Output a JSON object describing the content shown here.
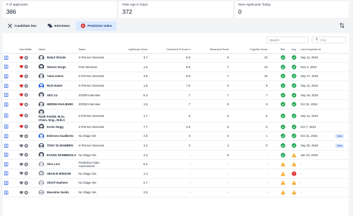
{
  "kpis": [
    {
      "label": "# of applicants",
      "value": "386"
    },
    {
      "label": "Role Age in Days",
      "value": "372"
    },
    {
      "label": "New Applicants Today",
      "value": "0"
    }
  ],
  "tabs": [
    {
      "label": "Candidate Sea",
      "icon": "candidate-search-icon",
      "active": false
    },
    {
      "label": "Interviews",
      "icon": "chat-bubbles-icon",
      "active": false
    },
    {
      "label": "Predictive Index",
      "icon": "pi-logo-icon",
      "active": true
    }
  ],
  "search": {
    "placeholder": "Search"
  },
  "filter": {
    "label": "Filter"
  },
  "columns": {
    "profile": "",
    "like_dislike": "Like Dislike",
    "name": "Name",
    "status": "Status",
    "lighthouse": "Lighthouse Score",
    "combined": "Combined Fit Score ▾",
    "behavioral": "Behavioral Score",
    "cognitive": "Cognitive Score",
    "bell": "Belt",
    "cog": "Cog",
    "last_completed": "Last Completed At",
    "badge": ""
  },
  "rows": [
    {
      "name": "Rahul Shinde",
      "avatar": "dark",
      "liked": true,
      "status": "In-Person Interview",
      "lighthouse": "3.7",
      "combined": "8.5",
      "behavioral": "9",
      "cognitive": "10",
      "bell": "ok",
      "cog": "ok",
      "date": "Sep 11, 2024",
      "badge": ""
    },
    {
      "name": "Steven Sorge",
      "avatar": "dark",
      "liked": true,
      "status": "First Interview",
      "lighthouse": "1.6",
      "combined": "8.5",
      "behavioral": "7",
      "cognitive": "10",
      "bell": "ok",
      "cog": "ok",
      "date": "Nov 4, 2024",
      "badge": ""
    },
    {
      "name": "Yaiza Azeez",
      "avatar": "dark",
      "liked": true,
      "status": "In-Person Interview",
      "lighthouse": "3.9",
      "combined": "8.5",
      "behavioral": "7",
      "cognitive": "10",
      "bell": "ok",
      "cog": "ok",
      "date": "Sep 17, 2024",
      "badge": ""
    },
    {
      "name": "Rick Hatter",
      "avatar": "blue",
      "liked": true,
      "status": "In-Person Interview",
      "lighthouse": "1.8",
      "combined": "7.5",
      "behavioral": "6",
      "cognitive": "9",
      "bell": "ok",
      "cog": "ok",
      "date": "Sep 11, 2024",
      "badge": ""
    },
    {
      "name": "SEX LU",
      "avatar": "dark",
      "liked": true,
      "status": "ZOOM Interview",
      "lighthouse": "5.3",
      "combined": "7",
      "behavioral": "7",
      "cognitive": "7",
      "bell": "ok",
      "cog": "ok",
      "date": "Sep 16, 2024",
      "badge": ""
    },
    {
      "name": "HEDEH KHAJEHEI",
      "avatar": "dark",
      "liked": true,
      "status": "ZOOM Interview",
      "lighthouse": "1.5",
      "combined": "7",
      "behavioral": "5",
      "cognitive": "9",
      "bell": "ok",
      "cog": "ok",
      "date": "Oct 31, 2024",
      "badge": ""
    },
    {
      "name": "Ralib FAKIM, M.Sc. Chem. Eng., M.B.A",
      "avatar": "dark",
      "liked": true,
      "status": "In-Person Interview",
      "lighthouse": "1.7",
      "combined": "6",
      "behavioral": "6",
      "cognitive": "6",
      "bell": "ok",
      "cog": "ok",
      "date": "Sep 11, 2024",
      "badge": ""
    },
    {
      "name": "Kevin Hogg",
      "avatar": "dark",
      "liked": true,
      "status": "In-Person Interview",
      "lighthouse": "7.7",
      "combined": "4.5",
      "behavioral": "9",
      "cognitive": "0",
      "bell": "ok",
      "cog": "ok",
      "date": "Oct 7, 2024",
      "badge": ""
    },
    {
      "name": "Ederson Gualberto",
      "avatar": "blue",
      "liked": false,
      "status": "No Stage Set",
      "lighthouse": "4.5",
      "combined": "3",
      "behavioral": "5",
      "cognitive": "1",
      "bell": "ok",
      "cog": "ok",
      "date": "Oct 31, 2024",
      "badge": "New"
    },
    {
      "name": "TONY DI MAMBRO",
      "avatar": "dark",
      "liked": false,
      "status": "In-Person Interview",
      "lighthouse": "3.2",
      "combined": "2",
      "behavioral": "4",
      "cognitive": "0",
      "bell": "ok",
      "cog": "ok",
      "date": "Sep 25, 2024",
      "badge": "New"
    },
    {
      "name": "EVANS SKINBINOLA",
      "avatar": "dark",
      "liked": false,
      "status": "No Stage Set",
      "lighthouse": "3.3",
      "combined": "-",
      "behavioral": "8",
      "cognitive": "-",
      "bell": "ok",
      "cog": "warn",
      "date": "Jan 23, 2025",
      "badge": ""
    },
    {
      "name": "Alex Levi",
      "avatar": "gray",
      "liked": false,
      "status": "Predictive Index Assessment",
      "lighthouse": "5.2",
      "combined": "-",
      "behavioral": "-",
      "cognitive": "-",
      "bell": "warn",
      "cog": "warn",
      "date": "-",
      "badge": ""
    },
    {
      "name": "SEAN B WINSOR",
      "avatar": "gray",
      "liked": false,
      "status": "No Stage Set",
      "lighthouse": "1.4",
      "combined": "-",
      "behavioral": "-",
      "cognitive": "-",
      "bell": "warn",
      "cog": "alert",
      "date": "-",
      "badge": ""
    },
    {
      "name": "Sherif Hashem",
      "avatar": "gray",
      "liked": false,
      "status": "No Stage Set",
      "lighthouse": "2.7",
      "combined": "-",
      "behavioral": "-",
      "cognitive": "-",
      "bell": "warn",
      "cog": "warn",
      "date": "-",
      "badge": ""
    },
    {
      "name": "Massimo Guido",
      "avatar": "gray",
      "liked": false,
      "status": "No Stage Set",
      "lighthouse": "3.8",
      "combined": "-",
      "behavioral": "-",
      "cognitive": "-",
      "bell": "warn",
      "cog": "warn",
      "date": "-",
      "badge": ""
    }
  ],
  "colors": {
    "like_red": "#dc2626",
    "dislike_gray": "#6b7280",
    "ok_green": "#16a34a",
    "warn_amber": "#f59e0b",
    "alert_red": "#dc2626",
    "profile_blue": "#2563eb",
    "active_tab_bg": "#dbeafe"
  }
}
